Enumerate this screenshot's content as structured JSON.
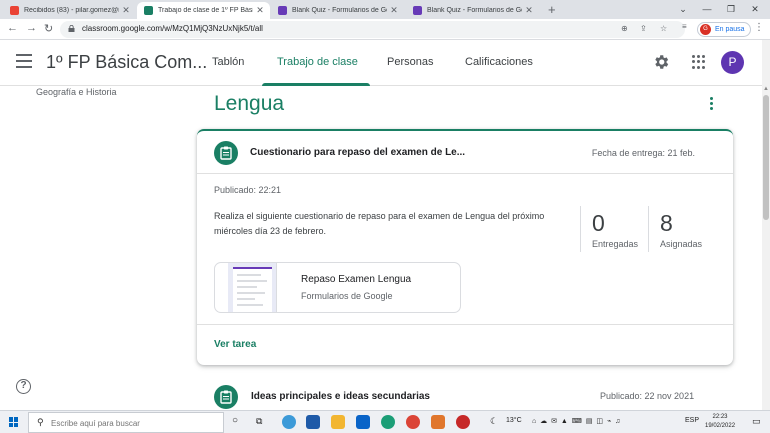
{
  "browser": {
    "tabs": [
      {
        "title": "Recibidos (83) - pilar.gomez@ies",
        "favicon_color": "#ea4335",
        "active": false
      },
      {
        "title": "Trabajo de clase de 1º FP Básica",
        "favicon_color": "#1a7f64",
        "active": true
      },
      {
        "title": "Blank Quiz - Formularios de Goo",
        "favicon_color": "#673ab7",
        "active": false
      },
      {
        "title": "Blank Quiz - Formularios de Goo",
        "favicon_color": "#673ab7",
        "active": false
      }
    ],
    "new_tab": "+",
    "url": "classroom.google.com/w/MzQ1MjQ3NzUxNjk5/t/all",
    "profile_initial": "G",
    "profile_status": "En pausa"
  },
  "classroom": {
    "class_name": "1º FP Básica Com...",
    "nav": [
      {
        "label": "Tablón",
        "active": false
      },
      {
        "label": "Trabajo de clase",
        "active": true
      },
      {
        "label": "Personas",
        "active": false
      },
      {
        "label": "Calificaciones",
        "active": false
      }
    ],
    "user_initial": "P",
    "accent": "#1a7f64"
  },
  "sidebar": {
    "topic": "Geografía e Historia"
  },
  "section": {
    "title": "Lengua"
  },
  "assignment": {
    "title": "Cuestionario para repaso del examen de Le...",
    "due": "Fecha de entrega: 21 feb.",
    "published": "Publicado: 22:21",
    "description": "Realiza el siguiente cuestionario de repaso para el examen de Lengua del próximo miércoles  día 23 de febrero.",
    "turned_in_count": "0",
    "turned_in_label": "Entregadas",
    "assigned_count": "8",
    "assigned_label": "Asignadas",
    "attachment": {
      "name": "Repaso Examen Lengua",
      "type": "Formularios de Google"
    },
    "view_link": "Ver tarea"
  },
  "next_item": {
    "title": "Ideas principales e ideas secundarias",
    "published": "Publicado: 22 nov 2021"
  },
  "taskbar": {
    "search_placeholder": "Escribe aquí para buscar",
    "temperature": "13°C",
    "language": "ESP",
    "time": "22:23",
    "date": "19/02/2022"
  }
}
